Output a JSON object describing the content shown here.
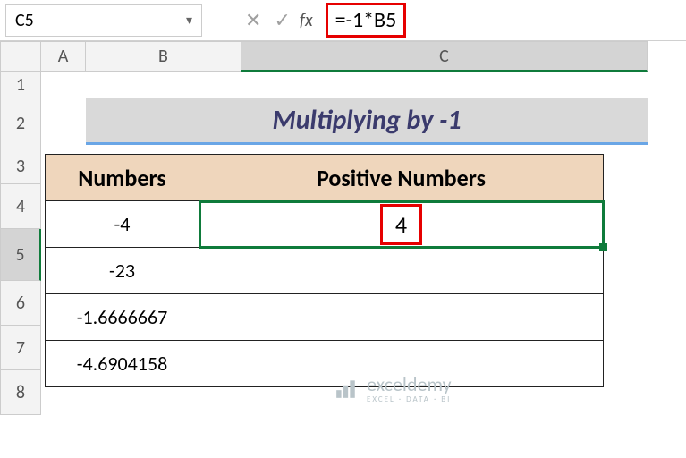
{
  "nameBox": "C5",
  "formula": "=-1*B5",
  "fxLabel": "fx",
  "columns": {
    "A": "A",
    "B": "B",
    "C": "C"
  },
  "rowLabels": [
    "1",
    "2",
    "3",
    "4",
    "5",
    "6",
    "7",
    "8"
  ],
  "title": "Multiplying by -1",
  "headers": {
    "numbers": "Numbers",
    "positive": "Positive Numbers"
  },
  "rowsData": [
    {
      "num": "-4",
      "pos": "4"
    },
    {
      "num": "-23",
      "pos": ""
    },
    {
      "num": "-1.6666667",
      "pos": ""
    },
    {
      "num": "-4.6904158",
      "pos": ""
    }
  ],
  "watermark": {
    "text": "exceldemy",
    "sub": "EXCEL · DATA · BI"
  },
  "chart_data": {
    "type": "table",
    "title": "Multiplying by -1",
    "columns": [
      "Numbers",
      "Positive Numbers"
    ],
    "rows": [
      [
        -4,
        4
      ],
      [
        -23,
        null
      ],
      [
        -1.6666667,
        null
      ],
      [
        -4.6904158,
        null
      ]
    ],
    "formula_c5": "=-1*B5"
  }
}
